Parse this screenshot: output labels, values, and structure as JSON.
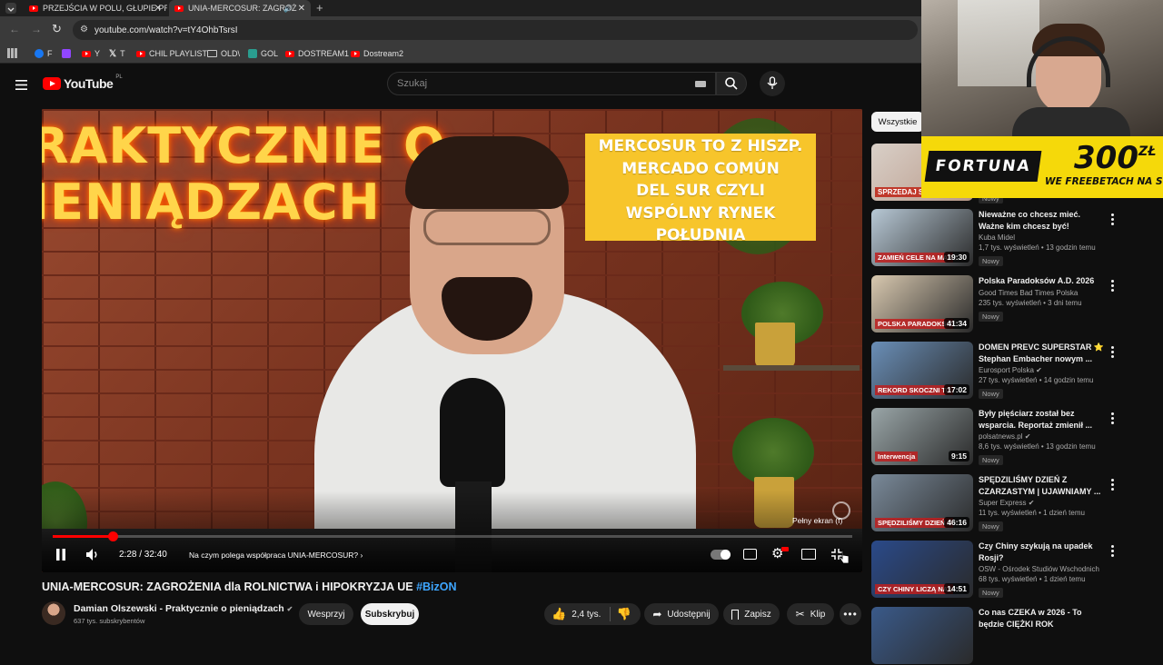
{
  "browser": {
    "tabs": [
      {
        "title": "PRZEJŚCIA W POLU, GŁUPIE PR",
        "active": false
      },
      {
        "title": "UNIA-MERCOSUR: ZAGROŻ",
        "active": true
      }
    ],
    "url": "youtube.com/watch?v=tY4OhbTsrsI",
    "bookmarks": [
      {
        "label": "F",
        "icon": "facebook-icon"
      },
      {
        "label": "",
        "icon": "twitch-icon"
      },
      {
        "label": "Y",
        "icon": "youtube-icon"
      },
      {
        "label": "T",
        "icon": "x-icon"
      },
      {
        "label": "CHIL PLAYLIST",
        "icon": "youtube-icon"
      },
      {
        "label": "OLD\\",
        "icon": "folder-icon"
      },
      {
        "label": "GOL",
        "icon": "gol-icon"
      },
      {
        "label": "DOSTREAM1",
        "icon": "youtube-icon"
      },
      {
        "label": "Dostream2",
        "icon": "youtube-icon"
      }
    ]
  },
  "youtube": {
    "logo": "YouTube",
    "region": "PL",
    "search_placeholder": "Szukaj"
  },
  "video": {
    "neon_line1": "RAKTYCZNIE O",
    "neon_line2": "IENIĄDZACH",
    "overlay_text": [
      "MERCOSUR TO Z HISZP.",
      "MERCADO COMÚN",
      "DEL SUR CZYLI",
      "WSPÓLNY RYNEK",
      "POŁUDNIA"
    ],
    "time": "2:28 / 32:40",
    "chapter": "Na czym polega współpraca UNIA-MERCOSUR?",
    "fullscreen_tooltip": "Pełny ekran (f)",
    "progress": 0.0755
  },
  "details": {
    "title": "UNIA-MERCOSUR: ZAGROŻENIA dla ROLNICTWA i HIPOKRYZJA UE",
    "hashtag": "#BizON",
    "channel": "Damian Olszewski - Praktycznie o pieniądzach",
    "subscribers": "637 tys. subskrybentów",
    "support_label": "Wesprzyj",
    "subscribe_label": "Subskrybuj",
    "likes": "2,4 tys.",
    "share_label": "Udostępnij",
    "save_label": "Zapisz",
    "clip_label": "Klip"
  },
  "sidebar": {
    "chip_all": "Wszystkie",
    "first_partial": {
      "thumb_text": "SPRZEDAJ SUKNIĘ",
      "new": "Nowy"
    },
    "items": [
      {
        "title": "Nieważne co chcesz mieć. Ważne kim chcesz być!",
        "channel": "Kuba Midel",
        "meta": "1,7 tys. wyświetleń • 13 godzin temu",
        "new": "Nowy",
        "duration": "19:30",
        "thumb_text": "ZAMIEŃ CELE NA MARZENIA",
        "verified": false,
        "thumb_color": "#b8c9d6"
      },
      {
        "title": "Polska Paradoksów A.D. 2026",
        "channel": "Good Times Bad Times Polska",
        "meta": "235 tys. wyświetleń • 3 dni temu",
        "new": "Nowy",
        "duration": "41:34",
        "thumb_text": "POLSKA PARADOKSÓW",
        "verified": false,
        "thumb_color": "#d9c9b0"
      },
      {
        "title": "DOMEN PREVC SUPERSTAR ⭐ Stephan Embacher nowym ...",
        "channel": "Eurosport Polska",
        "meta": "27 tys. wyświetleń • 14 godzin temu",
        "new": "Nowy",
        "duration": "17:02",
        "thumb_text": "REKORD SKOCZNI TO ZA MAŁO",
        "verified": true,
        "thumb_color": "#6a8fb8"
      },
      {
        "title": "Były pięściarz został bez wsparcia. Reportaż zmienił ...",
        "channel": "polsatnews.pl",
        "meta": "8,6 tys. wyświetleń • 13 godzin temu",
        "new": "Nowy",
        "duration": "9:15",
        "thumb_text": "Interwencja",
        "verified": true,
        "thumb_color": "#9aa6a8"
      },
      {
        "title": "SPĘDZILIŚMY DZIEŃ Z CZARZASTYM | UJAWNIAMY ...",
        "channel": "Super Express",
        "meta": "11 tys. wyświetleń • 1 dzień temu",
        "new": "Nowy",
        "duration": "46:16",
        "thumb_text": "SPĘDZILIŚMY DZIEŃ Z MARSZAŁKIEM CZARZ",
        "verified": true,
        "thumb_color": "#7a8a9a"
      },
      {
        "title": "Czy Chiny szykują na upadek Rosji?",
        "channel": "OSW - Ośrodek Studiów Wschodnich",
        "meta": "68 tys. wyświetleń • 1 dzień temu",
        "new": "Nowy",
        "duration": "14:51",
        "thumb_text": "CZY CHINY LICZĄ NA UPADEK ROSJI?",
        "verified": false,
        "thumb_color": "#2a4a8a"
      },
      {
        "title": "Co nas CZEKA w 2026 - To będzie CIĘŻKI ROK",
        "channel": "",
        "meta": "",
        "new": "",
        "duration": "",
        "thumb_text": "",
        "verified": false,
        "thumb_color": "#3a5a8a"
      }
    ]
  },
  "ad": {
    "brand": "FORTUNA",
    "amount": "300",
    "currency": "ZŁ",
    "subline": "WE FREEBETACH NA START"
  },
  "colors": {
    "yt_red": "#ff0000",
    "link_blue": "#3ea6ff",
    "ad_yellow": "#f5d90a",
    "overlay_yellow": "#f7c52b",
    "neon_yellow": "#ffd54a"
  }
}
